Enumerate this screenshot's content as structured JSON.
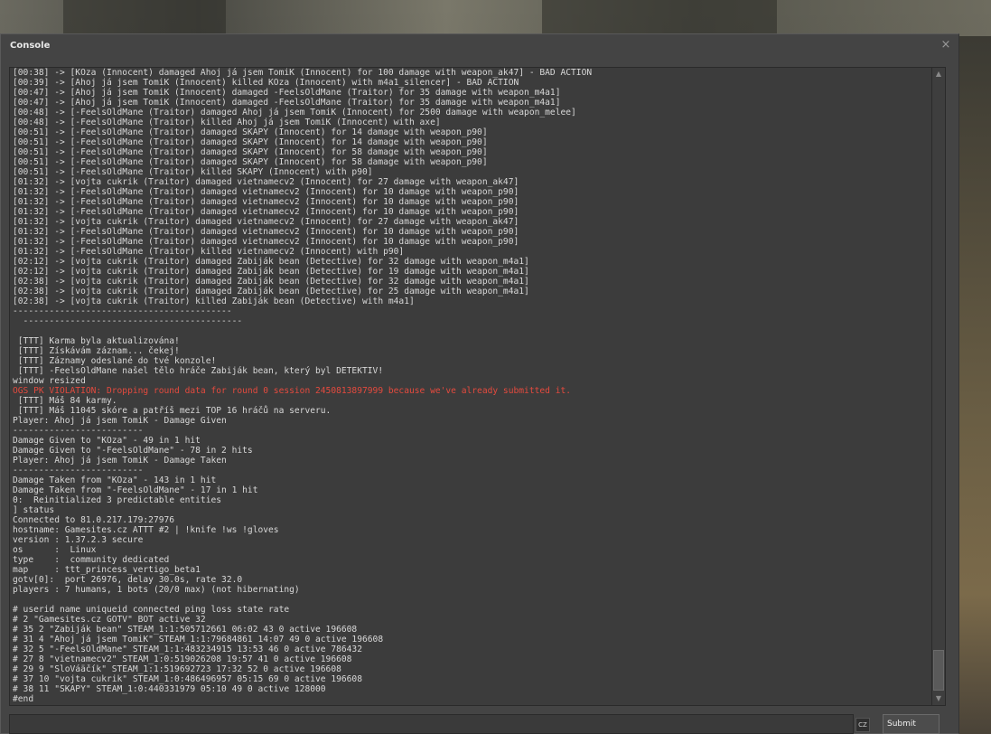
{
  "window": {
    "title": "Console",
    "close_glyph": "×"
  },
  "console": {
    "lines": [
      {
        "text": "[00:38] -> [KOza (Innocent) damaged Ahoj já jsem TomiK (Innocent) for 100 damage with weapon_ak47] - BAD ACTION",
        "type": "normal"
      },
      {
        "text": "[00:39] -> [Ahoj já jsem TomiK (Innocent) killed KOza (Innocent) with m4a1_silencer] - BAD ACTION",
        "type": "normal"
      },
      {
        "text": "[00:47] -> [Ahoj já jsem TomiK (Innocent) damaged -FeelsOldMane (Traitor) for 35 damage with weapon_m4a1]",
        "type": "normal"
      },
      {
        "text": "[00:47] -> [Ahoj já jsem TomiK (Innocent) damaged -FeelsOldMane (Traitor) for 35 damage with weapon_m4a1]",
        "type": "normal"
      },
      {
        "text": "[00:48] -> [-FeelsOldMane (Traitor) damaged Ahoj já jsem TomiK (Innocent) for 2500 damage with weapon_melee]",
        "type": "normal"
      },
      {
        "text": "[00:48] -> [-FeelsOldMane (Traitor) killed Ahoj já jsem TomiK (Innocent) with axe]",
        "type": "normal"
      },
      {
        "text": "[00:51] -> [-FeelsOldMane (Traitor) damaged SKAPY (Innocent) for 14 damage with weapon_p90]",
        "type": "normal"
      },
      {
        "text": "[00:51] -> [-FeelsOldMane (Traitor) damaged SKAPY (Innocent) for 14 damage with weapon_p90]",
        "type": "normal"
      },
      {
        "text": "[00:51] -> [-FeelsOldMane (Traitor) damaged SKAPY (Innocent) for 58 damage with weapon_p90]",
        "type": "normal"
      },
      {
        "text": "[00:51] -> [-FeelsOldMane (Traitor) damaged SKAPY (Innocent) for 58 damage with weapon_p90]",
        "type": "normal"
      },
      {
        "text": "[00:51] -> [-FeelsOldMane (Traitor) killed SKAPY (Innocent) with p90]",
        "type": "normal"
      },
      {
        "text": "[01:32] -> [vojta cukrik (Traitor) damaged vietnamecv2 (Innocent) for 27 damage with weapon_ak47]",
        "type": "normal"
      },
      {
        "text": "[01:32] -> [-FeelsOldMane (Traitor) damaged vietnamecv2 (Innocent) for 10 damage with weapon_p90]",
        "type": "normal"
      },
      {
        "text": "[01:32] -> [-FeelsOldMane (Traitor) damaged vietnamecv2 (Innocent) for 10 damage with weapon_p90]",
        "type": "normal"
      },
      {
        "text": "[01:32] -> [-FeelsOldMane (Traitor) damaged vietnamecv2 (Innocent) for 10 damage with weapon_p90]",
        "type": "normal"
      },
      {
        "text": "[01:32] -> [vojta cukrik (Traitor) damaged vietnamecv2 (Innocent) for 27 damage with weapon_ak47]",
        "type": "normal"
      },
      {
        "text": "[01:32] -> [-FeelsOldMane (Traitor) damaged vietnamecv2 (Innocent) for 10 damage with weapon_p90]",
        "type": "normal"
      },
      {
        "text": "[01:32] -> [-FeelsOldMane (Traitor) damaged vietnamecv2 (Innocent) for 10 damage with weapon_p90]",
        "type": "normal"
      },
      {
        "text": "[01:32] -> [-FeelsOldMane (Traitor) killed vietnamecv2 (Innocent) with p90]",
        "type": "normal"
      },
      {
        "text": "[02:12] -> [vojta cukrik (Traitor) damaged Zabiják bean (Detective) for 32 damage with weapon_m4a1]",
        "type": "normal"
      },
      {
        "text": "[02:12] -> [vojta cukrik (Traitor) damaged Zabiják bean (Detective) for 19 damage with weapon_m4a1]",
        "type": "normal"
      },
      {
        "text": "[02:38] -> [vojta cukrik (Traitor) damaged Zabiják bean (Detective) for 32 damage with weapon_m4a1]",
        "type": "normal"
      },
      {
        "text": "[02:38] -> [vojta cukrik (Traitor) damaged Zabiják bean (Detective) for 25 damage with weapon_m4a1]",
        "type": "normal"
      },
      {
        "text": "[02:38] -> [vojta cukrik (Traitor) killed Zabiják bean (Detective) with m4a1]",
        "type": "normal"
      },
      {
        "text": "------------------------------------------",
        "type": "normal"
      },
      {
        "text": "  ------------------------------------------",
        "type": "normal"
      },
      {
        "text": "",
        "type": "normal"
      },
      {
        "text": " [TTT] Karma byla aktualizována!",
        "type": "normal"
      },
      {
        "text": " [TTT] Získávám záznam... čekej!",
        "type": "normal"
      },
      {
        "text": " [TTT] Záznamy odeslané do tvé konzole!",
        "type": "normal"
      },
      {
        "text": " [TTT] -FeelsOldMane našel tělo hráče Zabiják bean, který byl DETEKTIV!",
        "type": "normal"
      },
      {
        "text": "window resized",
        "type": "normal"
      },
      {
        "text": "OGS PK VIOLATION: Dropping round data for round 0 session 2450813897999 because we've already submitted it.",
        "type": "error"
      },
      {
        "text": " [TTT] Máš 84 karmy.",
        "type": "normal"
      },
      {
        "text": " [TTT] Máš 11045 skóre a patříš mezi TOP 16 hráčů na serveru.",
        "type": "normal"
      },
      {
        "text": "Player: Ahoj já jsem TomiK - Damage Given",
        "type": "normal"
      },
      {
        "text": "-------------------------",
        "type": "normal"
      },
      {
        "text": "Damage Given to \"KOza\" - 49 in 1 hit",
        "type": "normal"
      },
      {
        "text": "Damage Given to \"-FeelsOldMane\" - 78 in 2 hits",
        "type": "normal"
      },
      {
        "text": "Player: Ahoj já jsem TomiK - Damage Taken",
        "type": "normal"
      },
      {
        "text": "-------------------------",
        "type": "normal"
      },
      {
        "text": "Damage Taken from \"KOza\" - 143 in 1 hit",
        "type": "normal"
      },
      {
        "text": "Damage Taken from \"-FeelsOldMane\" - 17 in 1 hit",
        "type": "normal"
      },
      {
        "text": "0:  Reinitialized 3 predictable entities",
        "type": "normal"
      },
      {
        "text": "] status",
        "type": "normal"
      },
      {
        "text": "Connected to 81.0.217.179:27976",
        "type": "normal"
      },
      {
        "text": "hostname: Gamesites.cz ATTT #2 | !knife !ws !gloves",
        "type": "normal"
      },
      {
        "text": "version : 1.37.2.3 secure",
        "type": "normal"
      },
      {
        "text": "os      :  Linux",
        "type": "normal"
      },
      {
        "text": "type    :  community dedicated",
        "type": "normal"
      },
      {
        "text": "map     : ttt_princess_vertigo_beta1",
        "type": "normal"
      },
      {
        "text": "gotv[0]:  port 26976, delay 30.0s, rate 32.0",
        "type": "normal"
      },
      {
        "text": "players : 7 humans, 1 bots (20/0 max) (not hibernating)",
        "type": "normal"
      },
      {
        "text": "",
        "type": "normal"
      },
      {
        "text": "# userid name uniqueid connected ping loss state rate",
        "type": "normal"
      },
      {
        "text": "# 2 \"Gamesites.cz GOTV\" BOT active 32",
        "type": "normal"
      },
      {
        "text": "# 35 2 \"Zabiják bean\" STEAM_1:1:505712661 06:02 43 0 active 196608",
        "type": "normal"
      },
      {
        "text": "# 31 4 \"Ahoj já jsem TomiK\" STEAM_1:1:79684861 14:07 49 0 active 196608",
        "type": "normal"
      },
      {
        "text": "# 32 5 \"-FeelsOldMane\" STEAM_1:1:483234915 13:53 46 0 active 786432",
        "type": "normal"
      },
      {
        "text": "# 27 8 \"vietnamecv2\" STEAM_1:0:519026208 19:57 41 0 active 196608",
        "type": "normal"
      },
      {
        "text": "# 29 9 \"SloVáäčík\" STEAM_1:1:519692723 17:32 52 0 active 196608",
        "type": "normal"
      },
      {
        "text": "# 37 10 \"vojta cukrik\" STEAM_1:0:486496957 05:15 69 0 active 196608",
        "type": "normal"
      },
      {
        "text": "# 38 11 \"SKAPY\" STEAM_1:0:440331979 05:10 49 0 active 128000",
        "type": "normal"
      },
      {
        "text": "#end",
        "type": "normal"
      }
    ]
  },
  "input": {
    "value": "",
    "placeholder": ""
  },
  "language_badge": "CZ",
  "submit_label": "Submit",
  "scrollbar": {
    "up_glyph": "▲",
    "down_glyph": "▼",
    "position_fraction": 0.95
  },
  "colors": {
    "text": "#d8d8d8",
    "error": "#e44a3e",
    "panel": "#444444"
  }
}
